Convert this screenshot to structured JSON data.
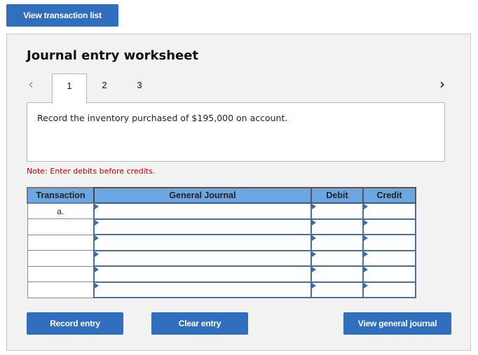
{
  "header": {
    "view_transaction_list_label": "View transaction list"
  },
  "worksheet": {
    "title": "Journal entry worksheet",
    "nav": {
      "prev_icon": "chevron-left-icon",
      "next_icon": "chevron-right-icon",
      "prev_glyph": "‹",
      "next_glyph": "›"
    },
    "tabs": [
      {
        "label": "1",
        "active": true
      },
      {
        "label": "2",
        "active": false
      },
      {
        "label": "3",
        "active": false
      }
    ],
    "description": "Record the inventory purchased of $195,000 on account.",
    "note": "Note: Enter debits before credits."
  },
  "table": {
    "columns": [
      "Transaction",
      "General Journal",
      "Debit",
      "Credit"
    ],
    "rows": [
      {
        "transaction": "a.",
        "account": "",
        "debit": "",
        "credit": ""
      },
      {
        "transaction": "",
        "account": "",
        "debit": "",
        "credit": ""
      },
      {
        "transaction": "",
        "account": "",
        "debit": "",
        "credit": ""
      },
      {
        "transaction": "",
        "account": "",
        "debit": "",
        "credit": ""
      },
      {
        "transaction": "",
        "account": "",
        "debit": "",
        "credit": ""
      },
      {
        "transaction": "",
        "account": "",
        "debit": "",
        "credit": ""
      }
    ]
  },
  "footer": {
    "record_entry_label": "Record entry",
    "clear_entry_label": "Clear entry",
    "view_general_journal_label": "View general journal"
  },
  "colors": {
    "button_blue": "#2f6fbe",
    "header_blue": "#6aa6e3",
    "note_red": "#c00000",
    "panel_bg": "#f2f2f2"
  }
}
